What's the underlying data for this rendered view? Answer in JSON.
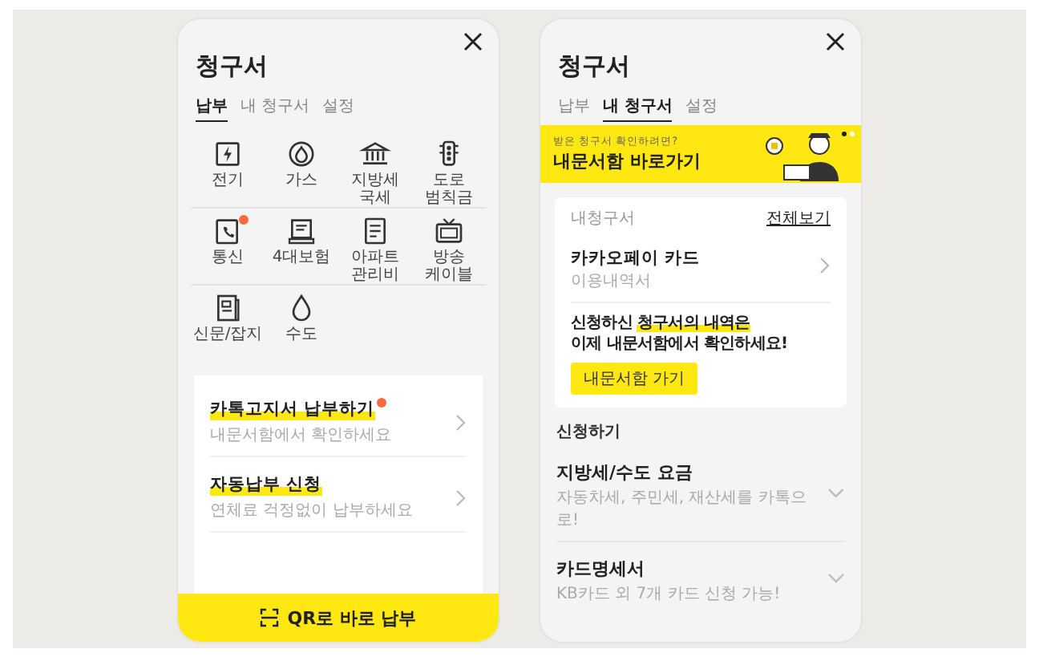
{
  "screens": [
    {
      "kind": "pay",
      "title": "청구서",
      "tabs": [
        {
          "label": "납부",
          "selected": true
        },
        {
          "label": "내 청구서",
          "selected": false
        },
        {
          "label": "설정",
          "selected": false
        }
      ],
      "services": [
        {
          "label": "전기",
          "badge": false
        },
        {
          "label": "가스",
          "badge": false
        },
        {
          "label": "지방세\n국세",
          "badge": false
        },
        {
          "label": "도로\n범칙금",
          "badge": false
        },
        {
          "label": "통신",
          "badge": true
        },
        {
          "label": "4대보험",
          "badge": false
        },
        {
          "label": "아파트\n관리비",
          "badge": false
        },
        {
          "label": "방송\n케이블",
          "badge": false
        },
        {
          "label": "신문/잡지",
          "badge": false
        },
        {
          "label": "수도",
          "badge": false
        }
      ],
      "menu": [
        {
          "title": "카톡고지서 납부하기",
          "subtitle": "내문서함에서 확인하세요",
          "badge": true
        },
        {
          "title": "자동납부 신청",
          "subtitle": "연체료 걱정없이 납부하세요",
          "badge": false
        }
      ],
      "qr_button": "QR로 바로 납부"
    },
    {
      "kind": "mybills",
      "title": "청구서",
      "tabs": [
        {
          "label": "납부",
          "selected": false
        },
        {
          "label": "내 청구서",
          "selected": true
        },
        {
          "label": "설정",
          "selected": false
        }
      ],
      "banner": {
        "caption": "받은 청구서 확인하려면?",
        "headline": "내문서함 바로가기",
        "page_dots": [
          {
            "selected": true
          },
          {
            "selected": false
          }
        ]
      },
      "bills_card": {
        "heading": "내청구서",
        "view_all": "전체보기",
        "item": {
          "title": "카카오페이 카드",
          "subtitle": "이용내역서"
        },
        "message": [
          "신청하신 **청구서의 내역은**",
          "이제 내문서함에서 확인하세요!"
        ],
        "button": "내문서함 가기"
      },
      "apply": {
        "heading": "신청하기",
        "items": [
          {
            "title": "지방세/수도 요금",
            "subtitle": "자동차세, 주민세, 재산세를 카톡으로!"
          },
          {
            "title": "카드명세서",
            "subtitle": "KB카드 외 7개 카드 신청 가능!"
          }
        ]
      }
    }
  ]
}
